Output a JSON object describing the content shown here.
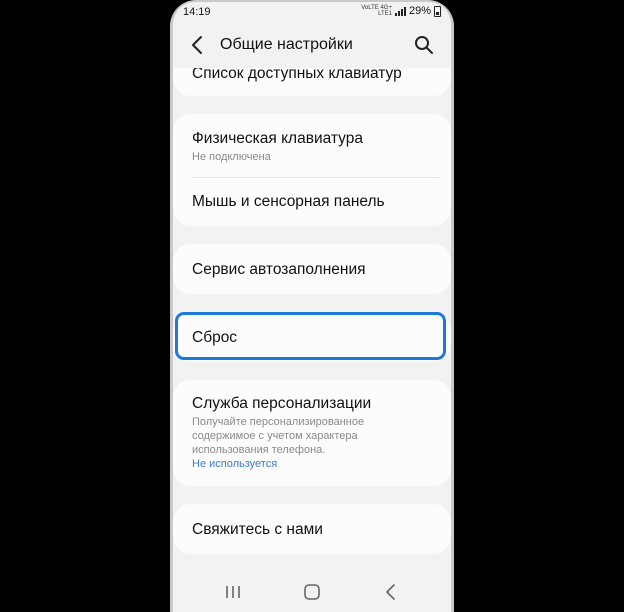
{
  "status_bar": {
    "time": "14:19",
    "signal_top": "VoLTE 4G+",
    "signal_bottom": "LTE1",
    "battery": "29%"
  },
  "header": {
    "title": "Общие настройки",
    "back_icon": "chevron-left-icon",
    "search_icon": "search-icon"
  },
  "items": {
    "available_keyboards": {
      "title": "Список доступных клавиатур"
    },
    "physical_keyboard": {
      "title": "Физическая клавиатура",
      "subtitle": "Не подключена"
    },
    "mouse_touchpad": {
      "title": "Мышь и сенсорная панель"
    },
    "autofill": {
      "title": "Сервис автозаполнения"
    },
    "reset": {
      "title": "Сброс"
    },
    "personalization": {
      "title": "Служба персонализации",
      "desc_line1": "Получайте персонализированное",
      "desc_line2": "содержимое с учетом характера",
      "desc_line3": "использования телефона.",
      "status": "Не используется"
    },
    "contact": {
      "title": "Свяжитесь с нами"
    }
  },
  "colors": {
    "highlight": "#1e7ad8",
    "link": "#3a7bd5",
    "background": "#f2f2f2",
    "card": "#fcfcfc"
  },
  "nav_bar": {
    "recents_icon": "recents-icon",
    "home_icon": "home-icon",
    "back_icon": "back-icon"
  }
}
